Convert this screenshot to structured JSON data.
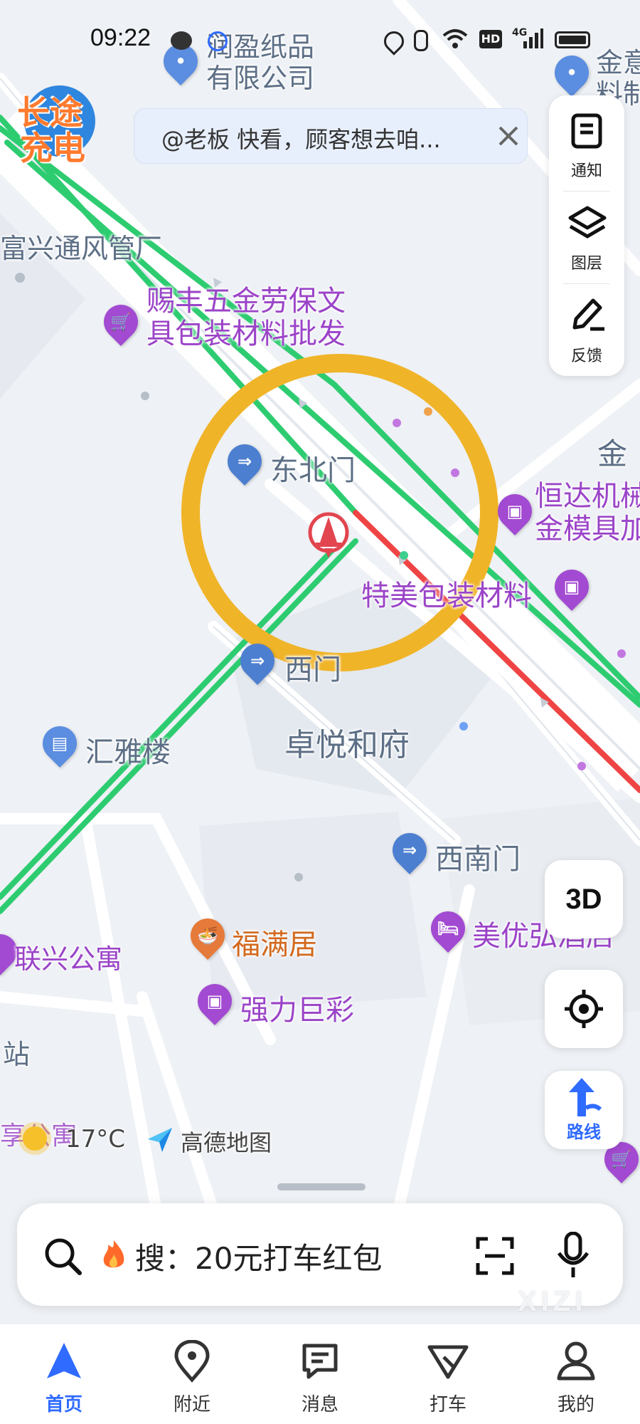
{
  "status_bar": {
    "time": "09:22",
    "network": "4G",
    "hd": "HD"
  },
  "brand_badge": {
    "line1": "长途",
    "line2": "充电"
  },
  "notice": {
    "text": "@老板 快看，顾客想去咱..."
  },
  "map_labels": {
    "company": "润盈纸品\n有限公司",
    "company_short": "润盈纸品",
    "company_line2": "有限公司",
    "top_right": "金意",
    "top_right2": "料制",
    "factory": "富兴通风管厂",
    "hardware_line1": "赐丰五金劳保文",
    "hardware_line2": "具包装材料批发",
    "northeast_gate": "东北门",
    "right_jin": "金",
    "hengda_line1": "恒达机械",
    "hengda_line2": "金模具加",
    "temei": "特美包装材料",
    "west_gate": "西门",
    "huiya": "汇雅楼",
    "zhuoyue": "卓悦和府",
    "southwest_gate": "西南门",
    "fuman": "福满居",
    "meiyou": "美优弘酒店",
    "lianxing": "联兴公寓",
    "qiangli": "强力巨彩",
    "station": "站",
    "xiang": "享公寓",
    "weather": "17°C",
    "amap": "高德地图"
  },
  "right_panel": {
    "notify": "通知",
    "layers": "图层",
    "feedback": "反馈"
  },
  "buttons": {
    "three_d": "3D",
    "route": "路线"
  },
  "search": {
    "prefix": "搜：",
    "text": "20元打车红包"
  },
  "bottom_nav": [
    {
      "label": "首页",
      "active": true
    },
    {
      "label": "附近",
      "active": false
    },
    {
      "label": "消息",
      "active": false
    },
    {
      "label": "打车",
      "active": false
    },
    {
      "label": "我的",
      "active": false
    }
  ],
  "watermark": "XIZI",
  "colors": {
    "accent": "#2f6bff",
    "green_road": "#2ecc71",
    "red_road": "#ef4444",
    "highlight": "#f0b429",
    "poi_purple": "#a24ad1"
  }
}
